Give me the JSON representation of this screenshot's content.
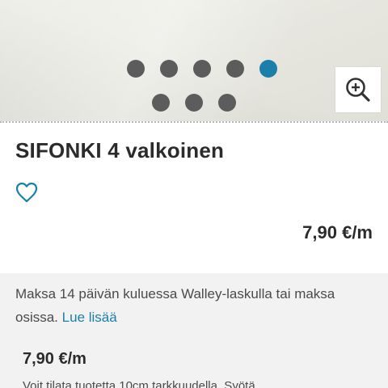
{
  "gallery": {
    "image_count": 8,
    "active_index": 5,
    "zoom_icon": "zoom-in-icon"
  },
  "product": {
    "title": "SIFONKI 4 valkoinen",
    "favorite_icon": "heart-outline-icon",
    "price": "7,90 €/m"
  },
  "payment": {
    "text": "Maksa 14 päivän kuluessa Walley-laskulla tai maksa osissa.",
    "link": "Lue lisää"
  },
  "details": {
    "price": "7,90 €/m",
    "info": "Voit tilata tuotetta 10cm tarkkuudella. Syötä"
  },
  "colors": {
    "accent": "#1b7fa9",
    "dot": "#5c5c5c",
    "text": "#2b2b2b"
  }
}
